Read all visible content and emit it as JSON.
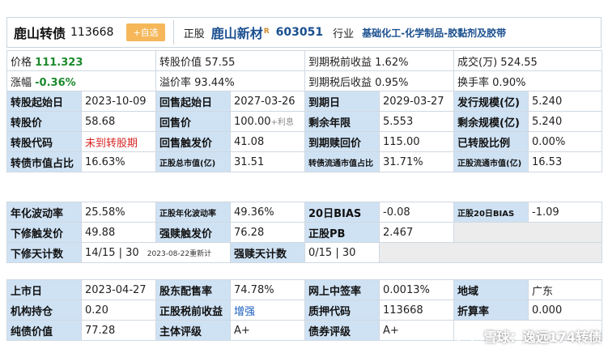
{
  "header": {
    "bond_name": "鹿山转债",
    "bond_code": "113668",
    "self_select": "+自选",
    "stock_label": "正股",
    "stock_name": "鹿山新材",
    "stock_sup": "R",
    "stock_code": "603051",
    "industry_label": "行业",
    "industry": "基础化工-化学制品-胶黏剂及胶带"
  },
  "quote": {
    "price_label": "价格",
    "price": "111.323",
    "change_label": "涨幅",
    "change": "-0.36%",
    "conv_value_label": "转股价值",
    "conv_value": "57.55",
    "premium_label": "溢价率",
    "premium": "93.44%",
    "ytm_pre_label": "到期税前收益",
    "ytm_pre": "1.62%",
    "ytm_post_label": "到期税后收益",
    "ytm_post": "0.95%",
    "turnover_amt_label": "成交(万)",
    "turnover_amt": "524.55",
    "turnover_rate_label": "换手率",
    "turnover_rate": "0.90%"
  },
  "terms": [
    [
      {
        "label": "转股起始日",
        "value": "2023-10-09"
      },
      {
        "label": "回售起始日",
        "value": "2027-03-26"
      },
      {
        "label": "到期日",
        "value": "2029-03-27"
      },
      {
        "label": "发行规模(亿)",
        "value": "5.240"
      }
    ],
    [
      {
        "label": "转股价",
        "value": "58.68"
      },
      {
        "label": "回售价",
        "value": "100.00",
        "extra": "+利息"
      },
      {
        "label": "剩余年限",
        "value": "5.553"
      },
      {
        "label": "剩余规模(亿)",
        "value": "5.240"
      }
    ],
    [
      {
        "label": "转股代码",
        "value": "未到转股期"
      },
      {
        "label": "回售触发价",
        "value": "41.08"
      },
      {
        "label": "到期赎回价",
        "value": "115.00"
      },
      {
        "label": "已转股比例",
        "value": "0.00%"
      }
    ],
    [
      {
        "label": "转债市值占比",
        "value": "16.63%"
      },
      {
        "label": "正股总市值(亿)",
        "value": "31.51"
      },
      {
        "label": "转债流通市值占比",
        "value": "31.71%"
      },
      {
        "label": "正股流通市值(亿)",
        "value": "16.53"
      }
    ]
  ],
  "risk": {
    "vol_label": "年化波动率",
    "vol": "25.58%",
    "stock_vol_label": "正股年化波动率",
    "stock_vol": "49.36%",
    "bias_label": "20日BIAS",
    "bias": "-0.08",
    "stock_bias_label": "正股20日BIAS",
    "stock_bias": "-1.09",
    "down_trigger_label": "下修触发价",
    "down_trigger": "49.88",
    "redeem_trigger_label": "强赎触发价",
    "redeem_trigger": "76.28",
    "pb_label": "正股PB",
    "pb": "2.467",
    "down_days_label": "下修天计数",
    "down_days": "14/15 | 30",
    "down_days_note": "2023-08-22重新计",
    "redeem_days_label": "强赎天计数",
    "redeem_days": "0/15 | 30"
  },
  "info": {
    "list_date_label": "上市日",
    "list_date": "2023-04-27",
    "placement_label": "股东配售率",
    "placement": "74.78%",
    "lottery_label": "网上中签率",
    "lottery": "0.0013%",
    "region_label": "地域",
    "region": "广东",
    "inst_label": "机构持仓",
    "inst": "0.20",
    "stock_ytm_label": "正股税前收益",
    "stock_ytm": "增强",
    "pledge_label": "质押代码",
    "pledge": "113668",
    "discount_label": "折算率",
    "discount": "0.000",
    "bond_value_label": "纯债价值",
    "bond_value": "77.28",
    "subject_rating_label": "主体评级",
    "subject_rating": "A+",
    "bond_rating_label": "债券评级",
    "bond_rating": "A+"
  },
  "watermark": "雪球：逸远174转债"
}
